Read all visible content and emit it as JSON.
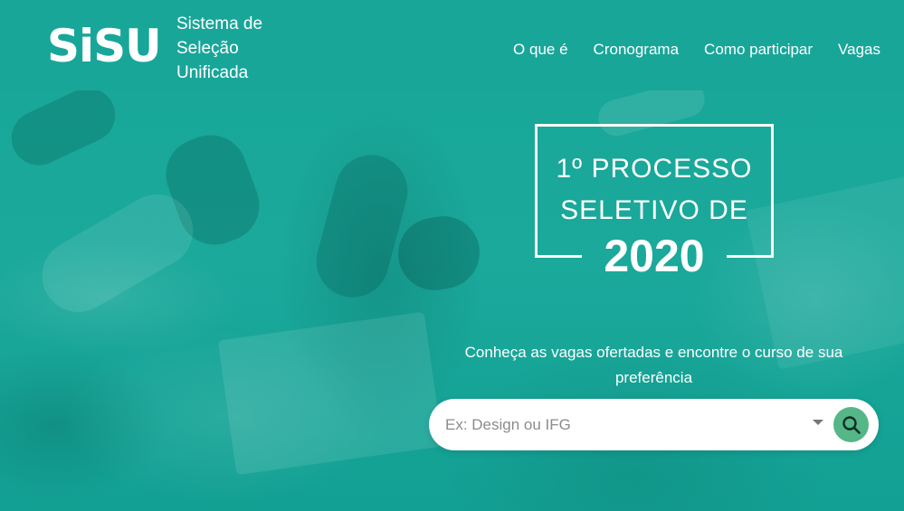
{
  "brand": {
    "logo_text": "SiSU",
    "tagline_line1": "Sistema de",
    "tagline_line2": "Seleção",
    "tagline_line3": "Unificada"
  },
  "nav": {
    "items": [
      {
        "label": "O que é"
      },
      {
        "label": "Cronograma"
      },
      {
        "label": "Como participar"
      },
      {
        "label": "Vagas"
      }
    ]
  },
  "hero": {
    "title_line1": "1º PROCESSO",
    "title_line2": "SELETIVO DE",
    "title_year": "2020",
    "subtitle": "Conheça as vagas ofertadas e encontre o curso de sua preferência"
  },
  "search": {
    "placeholder": "Ex: Design ou IFG",
    "value": "",
    "dropdown_icon": "caret-down-icon",
    "button_icon": "search-icon"
  },
  "colors": {
    "brand_teal": "#18a699",
    "search_button": "#55b687",
    "white": "#ffffff"
  }
}
